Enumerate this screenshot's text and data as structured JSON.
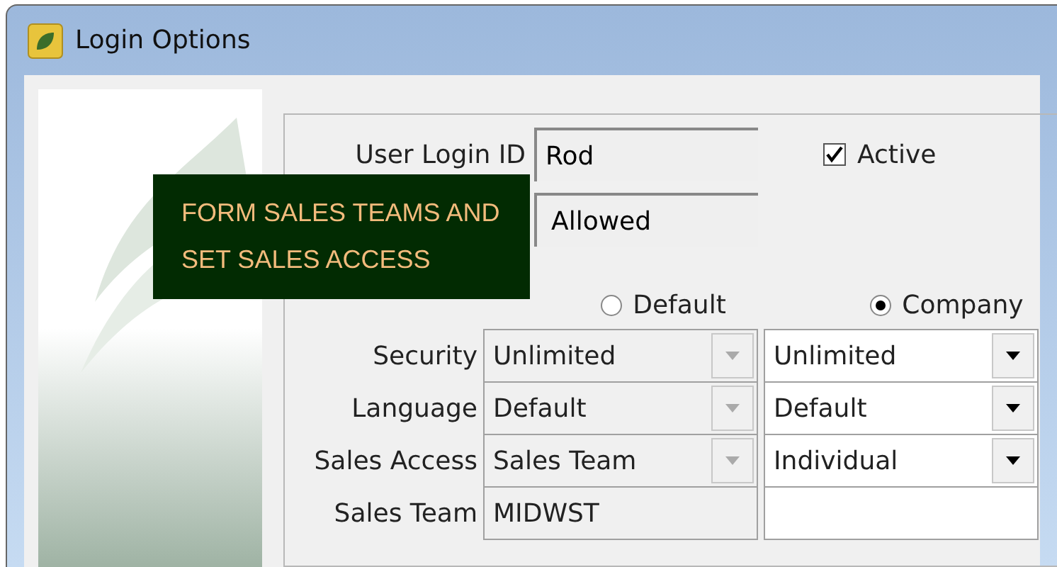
{
  "window": {
    "title": "Login Options"
  },
  "login": {
    "label": "User Login ID",
    "value": "Rod",
    "active": {
      "label": "Active",
      "checked": true
    },
    "second_value": "Allowed"
  },
  "columns": [
    {
      "label": "Default",
      "selected": false
    },
    {
      "label": "Company",
      "selected": true
    }
  ],
  "rows": [
    {
      "label": "Security",
      "kind": "dropdown",
      "default": "Unlimited",
      "company": "Unlimited"
    },
    {
      "label": "Language",
      "kind": "dropdown",
      "default": "Default",
      "company": "Default"
    },
    {
      "label": "Sales Access",
      "kind": "dropdown",
      "default": "Sales Team",
      "company": "Individual"
    },
    {
      "label": "Sales Team",
      "kind": "text",
      "default": "MIDWST",
      "company": ""
    }
  ],
  "callout": {
    "lines": [
      "FORM SALES TEAMS AND",
      "SET SALES ACCESS"
    ]
  }
}
